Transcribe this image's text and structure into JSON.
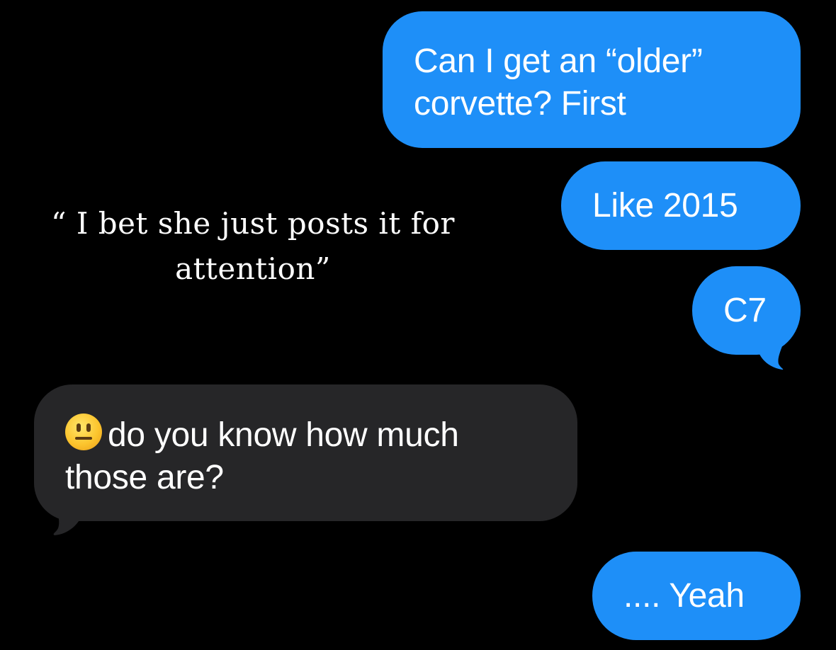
{
  "messages": [
    {
      "direction": "sent",
      "line1": "Can I get an “older”",
      "line2": "corvette? First"
    },
    {
      "direction": "sent",
      "text": "Like 2015"
    },
    {
      "direction": "sent",
      "text": "C7"
    },
    {
      "direction": "received",
      "emoji": "neutral-face-emoji",
      "line1": "do you know how much",
      "line2": "those are?"
    },
    {
      "direction": "sent",
      "text": ".... Yeah"
    }
  ],
  "overlay": {
    "line1": "“ I bet she just posts it for",
    "line2": "attention”"
  },
  "colors": {
    "background": "#000000",
    "sent_bubble": "#1E8FF8",
    "received_bubble": "#262628",
    "text": "#FFFFFF"
  }
}
